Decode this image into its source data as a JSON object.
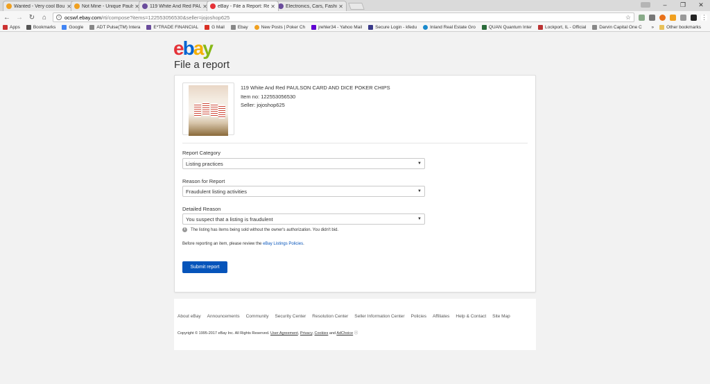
{
  "browser": {
    "tabs": [
      {
        "title": "Wanted - Very cool Bou",
        "fav_color": "#f0a020",
        "active": false
      },
      {
        "title": "Not Mine - Unique Paulso",
        "fav_color": "#f0a020",
        "active": false
      },
      {
        "title": "119 White And Red PAUL",
        "fav_color": "#6a4c9c",
        "active": false
      },
      {
        "title": "eBay - File a Report: Rep",
        "fav_color": "#e53238",
        "active": true
      },
      {
        "title": "Electronics, Cars, Fashio",
        "fav_color": "#6a4c9c",
        "active": false
      }
    ],
    "url_domain": "ocswf.ebay.com",
    "url_rest": "/rti/compose?items=122553056530&seller=jojoshop625",
    "bookmarks": [
      {
        "label": "Apps",
        "color": "#c33"
      },
      {
        "label": "Bookmarks",
        "color": "#555"
      },
      {
        "label": "Google",
        "color": "#4285f4"
      },
      {
        "label": "ADT Pulse(TM) Intera",
        "color": "#888"
      },
      {
        "label": "E*TRADE FINANCIAL",
        "color": "#6a4c9c"
      },
      {
        "label": "G Mail",
        "color": "#d93025"
      },
      {
        "label": "Ebay",
        "color": "#888"
      },
      {
        "label": "New Posts | Poker Ch",
        "color": "#f0a020"
      },
      {
        "label": "jrehler34 - Yahoo Mail",
        "color": "#6001d2"
      },
      {
        "label": "Secure Login - kfedu",
        "color": "#3a3a8a"
      },
      {
        "label": "Inland Real Estate Gro",
        "color": "#1a8acc"
      },
      {
        "label": "QUAN Quantum Inter",
        "color": "#2a6b3a"
      },
      {
        "label": "Lockport, IL - Official",
        "color": "#b33"
      },
      {
        "label": "Darvin Capital One C",
        "color": "#888"
      }
    ],
    "other_bookmarks": "Other bookmarks",
    "overflow": "»"
  },
  "page": {
    "title": "File a report",
    "item": {
      "name": "119 White And Red PAULSON CARD AND DICE POKER CHIPS",
      "item_no": "Item no: 122553056530",
      "seller": "Seller: jojoshop625"
    },
    "report_category": {
      "label": "Report Category",
      "value": "Listing practices"
    },
    "reason": {
      "label": "Reason for Report",
      "value": "Fraudulent listing activities"
    },
    "detailed": {
      "label": "Detailed Reason",
      "value": "You suspect that a listing is fraudulent"
    },
    "hint": "The listing has items being sold without the owner's authorization. You didn't bid.",
    "policy_prefix": "Before reporting an item, please review the ",
    "policy_link": "eBay Listings Policies",
    "policy_suffix": ".",
    "submit": "Submit report"
  },
  "footer": {
    "links": [
      "About eBay",
      "Announcements",
      "Community",
      "Security Center",
      "Resolution Center",
      "Seller Information Center",
      "Policies",
      "Affiliates",
      "Help & Contact",
      "Site Map"
    ],
    "copyright": "Copyright © 1995-2017 eBay Inc. All Rights Reserved.",
    "user_agreement": "User Agreement",
    "privacy": "Privacy",
    "cookies": "Cookies",
    "and": "and",
    "adchoice": "AdChoice"
  }
}
